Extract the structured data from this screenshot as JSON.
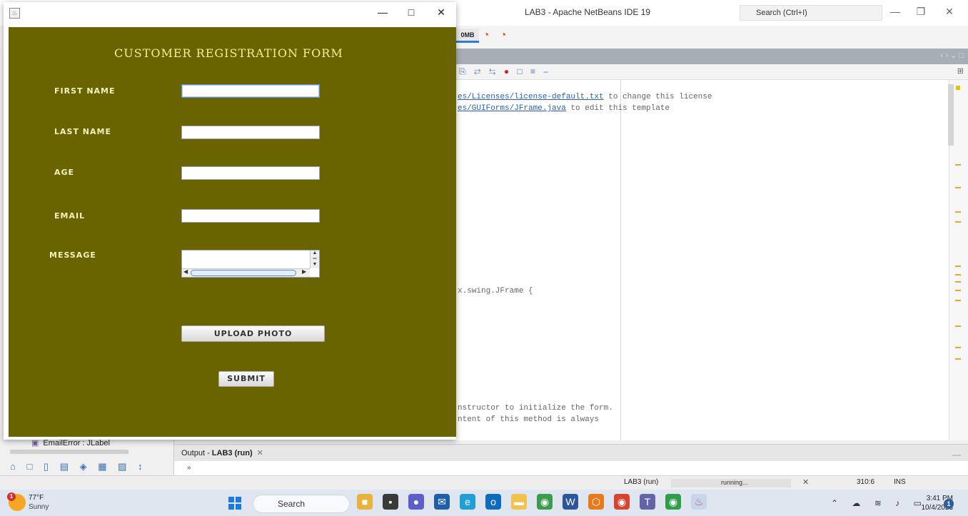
{
  "ide": {
    "title": "LAB3 - Apache NetBeans IDE 19",
    "search_placeholder": "Search (Ctrl+I)",
    "memory": "0MB",
    "code_lines": [
      {
        "link": "es/Licenses/license-default.txt",
        "rest": " to change this license"
      },
      {
        "link": "es/GUIForms/JFrame.java",
        "rest": " to edit this template"
      },
      {
        "text": "x.swing.JFrame {"
      },
      {
        "text": "nstructor to initialize the form."
      },
      {
        "text": "ntent of this method is always"
      }
    ],
    "navigator_node": "EmailError : JLabel",
    "output_tab_prefix": "Output - ",
    "output_tab_name": "LAB3 (run)",
    "output_arrow": "»",
    "status": {
      "run_label": "LAB3 (run)",
      "progress_text": "running...",
      "position": "310:6",
      "insert_mode": "INS"
    }
  },
  "taskbar": {
    "temperature": "77°F",
    "weather": "Sunny",
    "weather_badge": "1",
    "search_label": "Search",
    "time": "3:41 PM",
    "date": "10/4/2023",
    "notification_count": "1"
  },
  "frame": {
    "title": "",
    "form_title": "CUSTOMER REGISTRATION FORM",
    "labels": {
      "first_name": "FIRST NAME",
      "last_name": "LAST NAME",
      "age": "AGE",
      "email": "EMAIL",
      "message": "MESSAGE"
    },
    "values": {
      "first_name": "",
      "last_name": "",
      "age": "",
      "email": "",
      "message": ""
    },
    "buttons": {
      "upload": "UPLOAD PHOTO",
      "submit": "SUBMIT"
    }
  },
  "colors": {
    "form_background": "#696400",
    "form_label": "#f3f2c0"
  }
}
